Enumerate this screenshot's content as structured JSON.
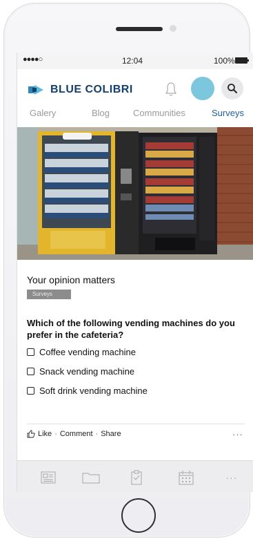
{
  "status_bar": {
    "signal": "●●●●○",
    "time": "12:04",
    "battery": "100%"
  },
  "header": {
    "logo_text": "BLUE COLIBRI",
    "brand_color": "#123f6b",
    "accent_color": "#1d5fa0",
    "avatar_color": "#7cc7dd"
  },
  "tabs": [
    {
      "label": "Galery",
      "active": false
    },
    {
      "label": "Blog",
      "active": false
    },
    {
      "label": "Communities",
      "active": false
    },
    {
      "label": "Surveys",
      "active": true
    }
  ],
  "post": {
    "title": "Your opinion matters",
    "tag": "Surveys",
    "question": "Which of the following vending machines do you prefer in the cafeteria?",
    "options": [
      {
        "label": "Coffee vending machine",
        "checked": false
      },
      {
        "label": "Snack vending machine",
        "checked": false
      },
      {
        "label": "Soft drink vending machine",
        "checked": false
      }
    ],
    "actions": {
      "like": "Like",
      "comment": "Comment",
      "share": "Share",
      "separator": "·",
      "more": "···"
    }
  },
  "bottom_nav": {
    "icons": [
      "news-icon",
      "folder-icon",
      "clipboard-icon",
      "calendar-icon",
      "more-icon"
    ],
    "more_label": "···"
  }
}
